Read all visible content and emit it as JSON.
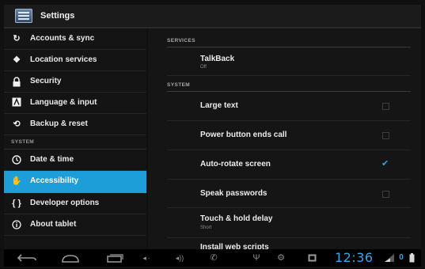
{
  "app": {
    "title": "Settings",
    "icon": "settings-app-icon"
  },
  "sidebar": {
    "items_top": [
      {
        "label": "Accounts & sync",
        "icon": "sync-icon"
      },
      {
        "label": "Location services",
        "icon": "location-icon"
      },
      {
        "label": "Security",
        "icon": "lock-icon"
      },
      {
        "label": "Language & input",
        "icon": "language-icon"
      },
      {
        "label": "Backup & reset",
        "icon": "backup-icon"
      }
    ],
    "system_header": "SYSTEM",
    "items_system": [
      {
        "label": "Date & time",
        "icon": "clock-icon"
      },
      {
        "label": "Accessibility",
        "icon": "hand-icon",
        "selected": true
      },
      {
        "label": "Developer options",
        "icon": "braces-icon"
      },
      {
        "label": "About tablet",
        "icon": "info-icon"
      }
    ]
  },
  "content": {
    "services_header": "SERVICES",
    "talkback": {
      "title": "TalkBack",
      "summary": "Off"
    },
    "system_header": "SYSTEM",
    "rows": [
      {
        "title": "Large text",
        "checked": false
      },
      {
        "title": "Power button ends call",
        "checked": false
      },
      {
        "title": "Auto-rotate screen",
        "checked": true
      },
      {
        "title": "Speak passwords",
        "checked": false
      }
    ],
    "touch_hold": {
      "title": "Touch & hold delay",
      "summary": "Short"
    },
    "partial_row": "Install web scripts"
  },
  "navbar": {
    "time": "12:36",
    "icons": [
      "back-icon",
      "home-icon",
      "recent-apps-icon",
      "volume-down-icon",
      "volume-up-icon",
      "phone-icon",
      "usb-icon",
      "settings-gear-icon",
      "screenshot-icon",
      "wifi-signal-icon",
      "battery-icon"
    ]
  },
  "colors": {
    "accent": "#1e9ed9",
    "clock": "#32a7e8"
  }
}
